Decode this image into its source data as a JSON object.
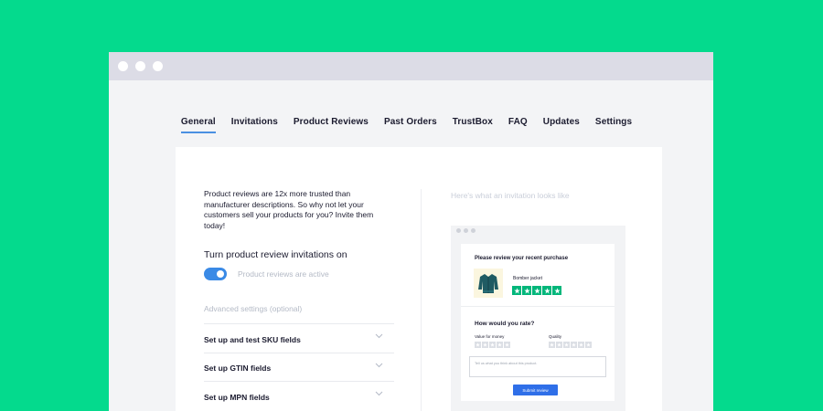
{
  "tabs": [
    {
      "label": "General",
      "active": true
    },
    {
      "label": "Invitations",
      "active": false
    },
    {
      "label": "Product Reviews",
      "active": false
    },
    {
      "label": "Past Orders",
      "active": false
    },
    {
      "label": "TrustBox",
      "active": false
    },
    {
      "label": "FAQ",
      "active": false
    },
    {
      "label": "Updates",
      "active": false
    },
    {
      "label": "Settings",
      "active": false
    }
  ],
  "intro_text": "Product reviews are 12x more trusted than manufacturer descriptions. So why not let your customers sell your products for you? Invite them today!",
  "toggle": {
    "heading": "Turn product review invitations on",
    "status": "Product reviews are active",
    "on": true
  },
  "advanced": {
    "heading": "Advanced settings (optional)",
    "items": [
      {
        "label": "Set up and test SKU fields"
      },
      {
        "label": "Set up GTIN fields"
      },
      {
        "label": "Set up MPN fields"
      }
    ]
  },
  "preview": {
    "heading": "Here's what an invitation looks like",
    "email": {
      "title": "Please review your recent purchase",
      "product_name": "Bomber jacket",
      "rating_stars": 5,
      "rate_title": "How would you rate?",
      "criteria": [
        "Value for money",
        "Quality"
      ],
      "review_placeholder": "Tell us what you think about this product.",
      "submit_label": "Submit review"
    }
  },
  "colors": {
    "background": "#04da8d",
    "accent": "#4a90e2",
    "toggle": "#3a8ae6",
    "star_green": "#00b67a",
    "submit": "#2f6fe8"
  },
  "icons": [
    "chevron-down-icon",
    "jacket-icon",
    "star-icon"
  ]
}
